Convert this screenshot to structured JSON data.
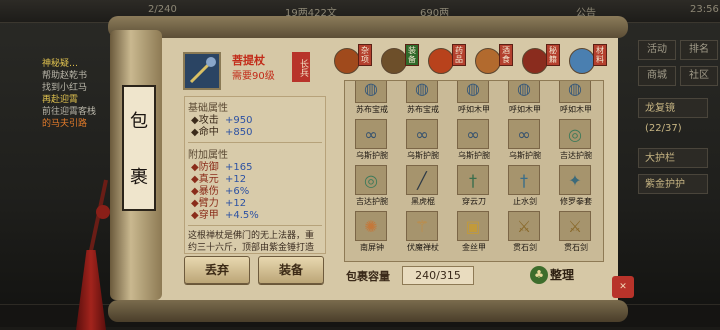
{
  "topbar": {
    "time": "23:56",
    "exp": "2/240",
    "money_cn": "19两422文",
    "gold": "690两",
    "announce": "公告"
  },
  "left_quests": [
    {
      "title": "神秘疑…",
      "lines": [
        "帮助赵乾书",
        "找到小红马"
      ]
    },
    {
      "title": "再赴迎霄",
      "lines": [
        "前往迎霄客栈",
        "的马夫引路"
      ]
    }
  ],
  "right_panel": {
    "btn1": "活动",
    "btn2": "排名",
    "btn3": "商城",
    "btn4": "社区",
    "btn5": "龙复镜",
    "level": "(22/37)",
    "btn6": "大护栏",
    "btn7": "紫金护护"
  },
  "scroll_title": [
    "包",
    "裹"
  ],
  "item": {
    "name": "菩提杖",
    "requirement": "需要90级",
    "stamp": "长兵"
  },
  "basic_attrs": {
    "heading": "基础属性",
    "items": [
      {
        "name": "攻击",
        "value": "+950"
      },
      {
        "name": "命中",
        "value": "+850"
      }
    ]
  },
  "extra_attrs": {
    "heading": "附加属性",
    "items": [
      {
        "name": "防御",
        "value": "+165"
      },
      {
        "name": "真元",
        "value": "+12"
      },
      {
        "name": "暴伤",
        "value": "+6%"
      },
      {
        "name": "臂力",
        "value": "+12"
      },
      {
        "name": "穿甲",
        "value": "+4.5%"
      }
    ]
  },
  "description": "这根禅杖是佛门的无上法器，重约三十六斤，顶部由紫金锤打造镶嵌，从菩提树……",
  "buttons": {
    "discard": "丢弃",
    "equip": "装备",
    "sort": "整理"
  },
  "tabs": [
    {
      "label": "杂项",
      "icon": "misc-icon",
      "color": "#a04a1c"
    },
    {
      "label": "装备",
      "icon": "equip-icon",
      "color": "#6d4f2a"
    },
    {
      "label": "药品",
      "icon": "medicine-icon",
      "color": "#b8421c"
    },
    {
      "label": "酒食",
      "icon": "food-icon",
      "color": "#b26a2e"
    },
    {
      "label": "秘籍",
      "icon": "book-icon",
      "color": "#8a2c1e"
    },
    {
      "label": "材料",
      "icon": "material-icon",
      "color": "#4a7fb0"
    }
  ],
  "grid": [
    {
      "label": "苏布宝戒",
      "glyph": "◍"
    },
    {
      "label": "苏布宝戒",
      "glyph": "◍"
    },
    {
      "label": "呼如木甲",
      "glyph": "◍"
    },
    {
      "label": "呼如木甲",
      "glyph": "◍"
    },
    {
      "label": "呼如木甲",
      "glyph": "◍"
    },
    {
      "label": "乌斯护腕",
      "glyph": "∞"
    },
    {
      "label": "乌斯护腕",
      "glyph": "∞"
    },
    {
      "label": "乌斯护腕",
      "glyph": "∞"
    },
    {
      "label": "乌斯护腕",
      "glyph": "∞"
    },
    {
      "label": "吉达护腕",
      "glyph": "◎"
    },
    {
      "label": "吉达护腕",
      "glyph": "◎"
    },
    {
      "label": "黑虎棍",
      "glyph": "╱"
    },
    {
      "label": "穿云刀",
      "glyph": "†"
    },
    {
      "label": "止水剑",
      "glyph": "†"
    },
    {
      "label": "修罗拳套",
      "glyph": "✦"
    },
    {
      "label": "南屏钟",
      "glyph": "✺"
    },
    {
      "label": "伏魔禅杖",
      "glyph": "⚚"
    },
    {
      "label": "金丝甲",
      "glyph": "▣"
    },
    {
      "label": "贯石剑",
      "glyph": "⚔"
    },
    {
      "label": "贯石剑",
      "glyph": "⚔"
    }
  ],
  "capacity": {
    "label": "包裹容量",
    "value": "240/315"
  },
  "colors": {
    "parchment": "#d6c8a6",
    "stat_value": "#2d52a3",
    "item_name": "#c22a18"
  }
}
